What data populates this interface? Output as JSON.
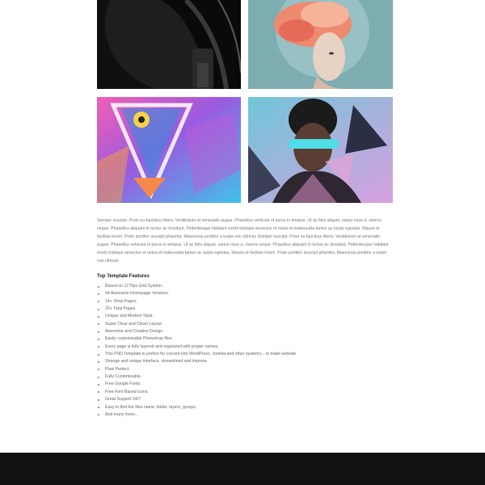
{
  "gallery": {
    "images": [
      {
        "alt": "headphones"
      },
      {
        "alt": "woman with colorful smoke"
      },
      {
        "alt": "colorful lion face with triangle"
      },
      {
        "alt": "man with neon glasses"
      }
    ]
  },
  "description": "Semper suscipit. Proin eu faucibus libero. Vestibulum at venenatis augue. Phasellus vehicula ut purus in tempus. Ut ac felis aliquet, varius risus a, viverra neque. Phasellus aliquam in lectus ac tincidunt. Pellentesque habitant morbi tristique senectus et netus et malesuada fames ac turpis egestas. Mauris et facilisis lorem. Proin porttitor suscipit pharetra. Maecenas porttitor a turpis non ultrices Semper suscipit. Proin eu faucibus libero. Vestibulum at venenatis augue. Phasellus vehicula ut purus in tempus. Ut ac felis aliquet, varius risus a, viverra neque. Phasellus aliquam in lectus ac tincidunt. Pellentesque habitant morbi tristique senectus et netus et malesuada fames ac turpis egestas. Mauris et facilisis lorem. Proin porttitor suscipit pharetra. Maecenas porttitor a turpis non ultrices.",
  "features": {
    "title": "Top Template Features",
    "items": [
      "Based on 1170px Grid System.",
      "04 Awesome Homepage Versions.",
      "14+ Shop Pages.",
      "25+ Total Pages.",
      "Unique and Modern Style.",
      "Super Clear and Clean Layout.",
      "Awesome and Creative Design.",
      "Easily customizable Photoshop files.",
      "Every page is fully layered and organized with proper names.",
      "This PSD Template is perfect for convert into WordPress, Joomla and other systems... to make website",
      "Strange and unique interface, streamlined and impress",
      "Pixel Perfect.",
      "Fully Customizable.",
      "Free Google Fonts.",
      "Free Font Based Icons.",
      "Great Support 24/7.",
      "Easy to find the files name, folder, layers, groups.",
      "And many more..."
    ]
  },
  "colors": {
    "footer": "#111111",
    "text": "#777777"
  }
}
